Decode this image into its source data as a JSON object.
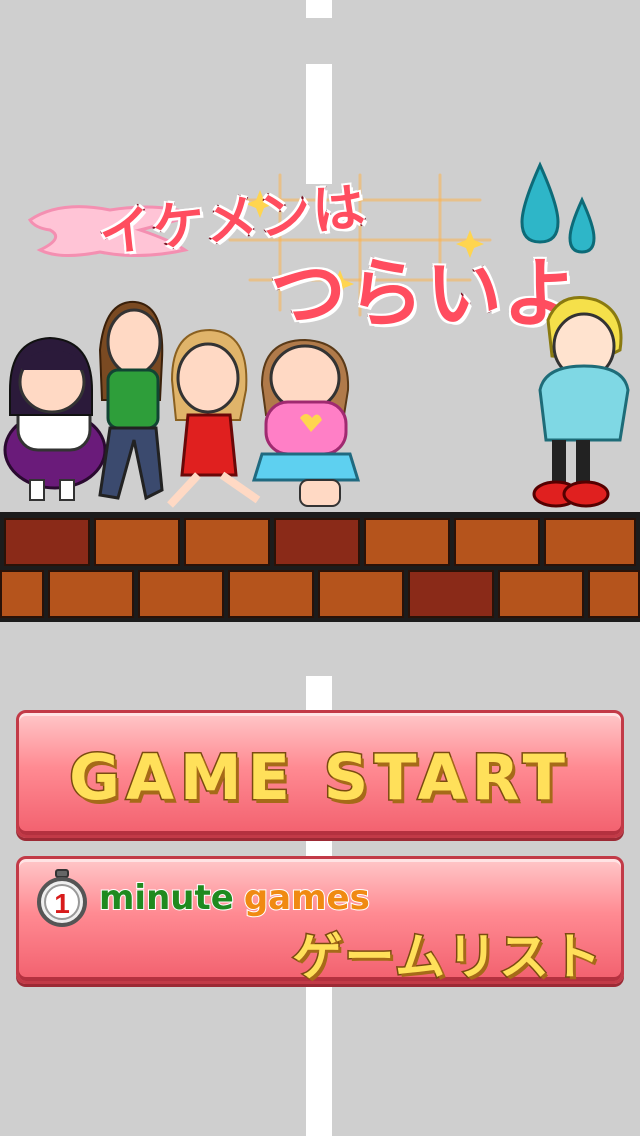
{
  "title": {
    "line1": "イケメンは",
    "line2": "つらいよ"
  },
  "buttons": {
    "start_label": "GAME START",
    "list_number": "1",
    "list_minute": "minute",
    "list_games": "games",
    "list_label": "ゲームリスト"
  },
  "colors": {
    "road": "#cfcfcf",
    "lane": "#ffffff",
    "button_pink": "#f2606e",
    "button_text": "#ffe05a",
    "brick": "#b5541c",
    "brick_dark": "#8a2a18"
  }
}
